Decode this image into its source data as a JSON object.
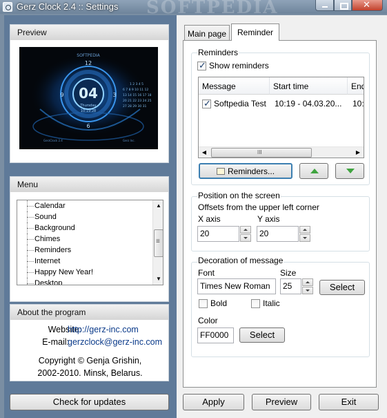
{
  "window": {
    "title": "Gerz Clock 2.4 :: Settings",
    "watermark": "SOFTPEDIA"
  },
  "preview": {
    "header": "Preview",
    "clock_hour": "04",
    "clock_day": "Thursday",
    "clock_time": "10:19:28"
  },
  "menu": {
    "header": "Menu",
    "items": [
      "Calendar",
      "Sound",
      "Background",
      "Chimes",
      "Reminders",
      "Internet",
      "Happy New Year!",
      "Desktop"
    ]
  },
  "about": {
    "header": "About the program",
    "website_label": "Website:",
    "website_value": "http://gerz-inc.com",
    "email_label": "E-mail:",
    "email_value": "gerzclock@gerz-inc.com",
    "copyright_line1": "Copyright © Genja Grishin,",
    "copyright_line2": "2002-2010. Minsk, Belarus."
  },
  "check_updates_label": "Check for updates",
  "tabs": [
    {
      "label": "Main page",
      "active": false
    },
    {
      "label": "Reminder",
      "active": true
    }
  ],
  "reminders": {
    "group_title": "Reminders",
    "show_label": "Show reminders",
    "show_checked": true,
    "columns": [
      "Message",
      "Start time",
      "End"
    ],
    "rows": [
      {
        "checked": true,
        "message": "Softpedia Test",
        "start": "10:19 - 04.03.20...",
        "end": "10:"
      }
    ],
    "reminders_button": "Reminders..."
  },
  "position": {
    "group_title": "Position on the screen",
    "description": "Offsets from the upper left corner",
    "x_label": "X axis",
    "x_value": "20",
    "y_label": "Y axis",
    "y_value": "20"
  },
  "decoration": {
    "group_title": "Decoration of message",
    "font_label": "Font",
    "font_value": "Times New Roman",
    "size_label": "Size",
    "size_value": "25",
    "font_select": "Select",
    "bold_label": "Bold",
    "bold_checked": false,
    "italic_label": "Italic",
    "italic_checked": false,
    "color_label": "Color",
    "color_value": "FF0000",
    "color_select": "Select"
  },
  "footer": {
    "apply": "Apply",
    "preview": "Preview",
    "exit": "Exit"
  },
  "colors": {
    "window_frame": "#5f7a99",
    "link": "#0a3a8a",
    "arrow": "#3fa43f",
    "default_button_border": "#3c7fb1"
  }
}
